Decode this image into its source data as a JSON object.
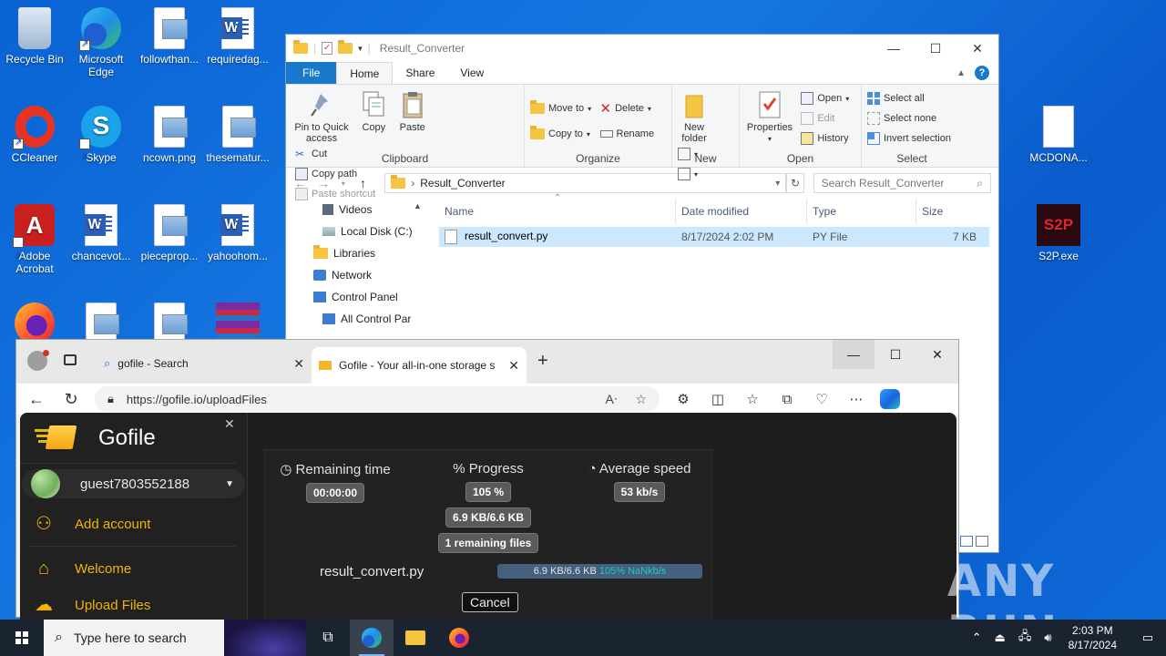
{
  "desktop": {
    "icons": [
      {
        "label": "Recycle Bin",
        "icon": "recycle-bin-icon"
      },
      {
        "label": "Microsoft Edge",
        "icon": "edge-icon"
      },
      {
        "label": "followthan...",
        "icon": "image-file-icon"
      },
      {
        "label": "requiredag...",
        "icon": "word-doc-icon"
      },
      {
        "label": "CCleaner",
        "icon": "ccleaner-icon"
      },
      {
        "label": "Skype",
        "icon": "skype-icon"
      },
      {
        "label": "ncown.png",
        "icon": "image-file-icon"
      },
      {
        "label": "thesematur...",
        "icon": "image-file-icon"
      },
      {
        "label": "Adobe Acrobat",
        "icon": "acrobat-icon"
      },
      {
        "label": "chancevot...",
        "icon": "word-doc-icon"
      },
      {
        "label": "pieceprop...",
        "icon": "image-file-icon"
      },
      {
        "label": "yahoohom...",
        "icon": "word-doc-icon"
      },
      {
        "label": "MCDONA...",
        "icon": "blank-file-icon"
      },
      {
        "label": "S2P.exe",
        "icon": "s2p-app-icon"
      }
    ],
    "watermark": "ANY RUN"
  },
  "explorer": {
    "title": "Result_Converter",
    "tabs": {
      "file": "File",
      "home": "Home",
      "share": "Share",
      "view": "View"
    },
    "ribbon": {
      "clipboard": {
        "name": "Clipboard",
        "pin": "Pin to Quick access",
        "copy": "Copy",
        "paste": "Paste",
        "cut": "Cut",
        "copy_path": "Copy path",
        "paste_shortcut": "Paste shortcut"
      },
      "organize": {
        "name": "Organize",
        "move_to": "Move to",
        "copy_to": "Copy to",
        "delete": "Delete",
        "rename": "Rename"
      },
      "new": {
        "name": "New",
        "new_folder": "New folder"
      },
      "open": {
        "name": "Open",
        "properties": "Properties",
        "open": "Open",
        "edit": "Edit",
        "history": "History"
      },
      "select": {
        "name": "Select",
        "select_all": "Select all",
        "select_none": "Select none",
        "invert": "Invert selection"
      }
    },
    "address": {
      "path": "Result_Converter",
      "search_placeholder": "Search Result_Converter"
    },
    "nav": [
      "Videos",
      "Local Disk (C:)",
      "Libraries",
      "Network",
      "Control Panel",
      "All Control Par"
    ],
    "columns": {
      "name": "Name",
      "date": "Date modified",
      "type": "Type",
      "size": "Size"
    },
    "files": [
      {
        "name": "result_convert.py",
        "date": "8/17/2024 2:02 PM",
        "type": "PY File",
        "size": "7 KB"
      }
    ]
  },
  "browser": {
    "tabs": [
      {
        "title": "gofile - Search"
      },
      {
        "title": "Gofile - Your all-in-one storage s"
      }
    ],
    "url": "https://gofile.io/uploadFiles",
    "gofile": {
      "brand": "Gofile",
      "user": "guest7803552188",
      "menu": {
        "add_account": "Add account",
        "welcome": "Welcome",
        "upload": "Upload Files"
      },
      "upload": {
        "remaining_label": "Remaining time",
        "remaining_value": "00:00:00",
        "progress_label": "% Progress",
        "progress_value": "105 %",
        "size_value": "6.9 KB/6.6 KB",
        "remaining_files": "1 remaining files",
        "speed_label": "Average speed",
        "speed_value": "53 kb/s",
        "file_name": "result_convert.py",
        "bar_text": "6.9 KB/6.6 KB",
        "bar_extra": "105% NaNkb/s",
        "cancel": "Cancel"
      }
    }
  },
  "taskbar": {
    "search_placeholder": "Type here to search",
    "time": "2:03 PM",
    "date": "8/17/2024"
  }
}
